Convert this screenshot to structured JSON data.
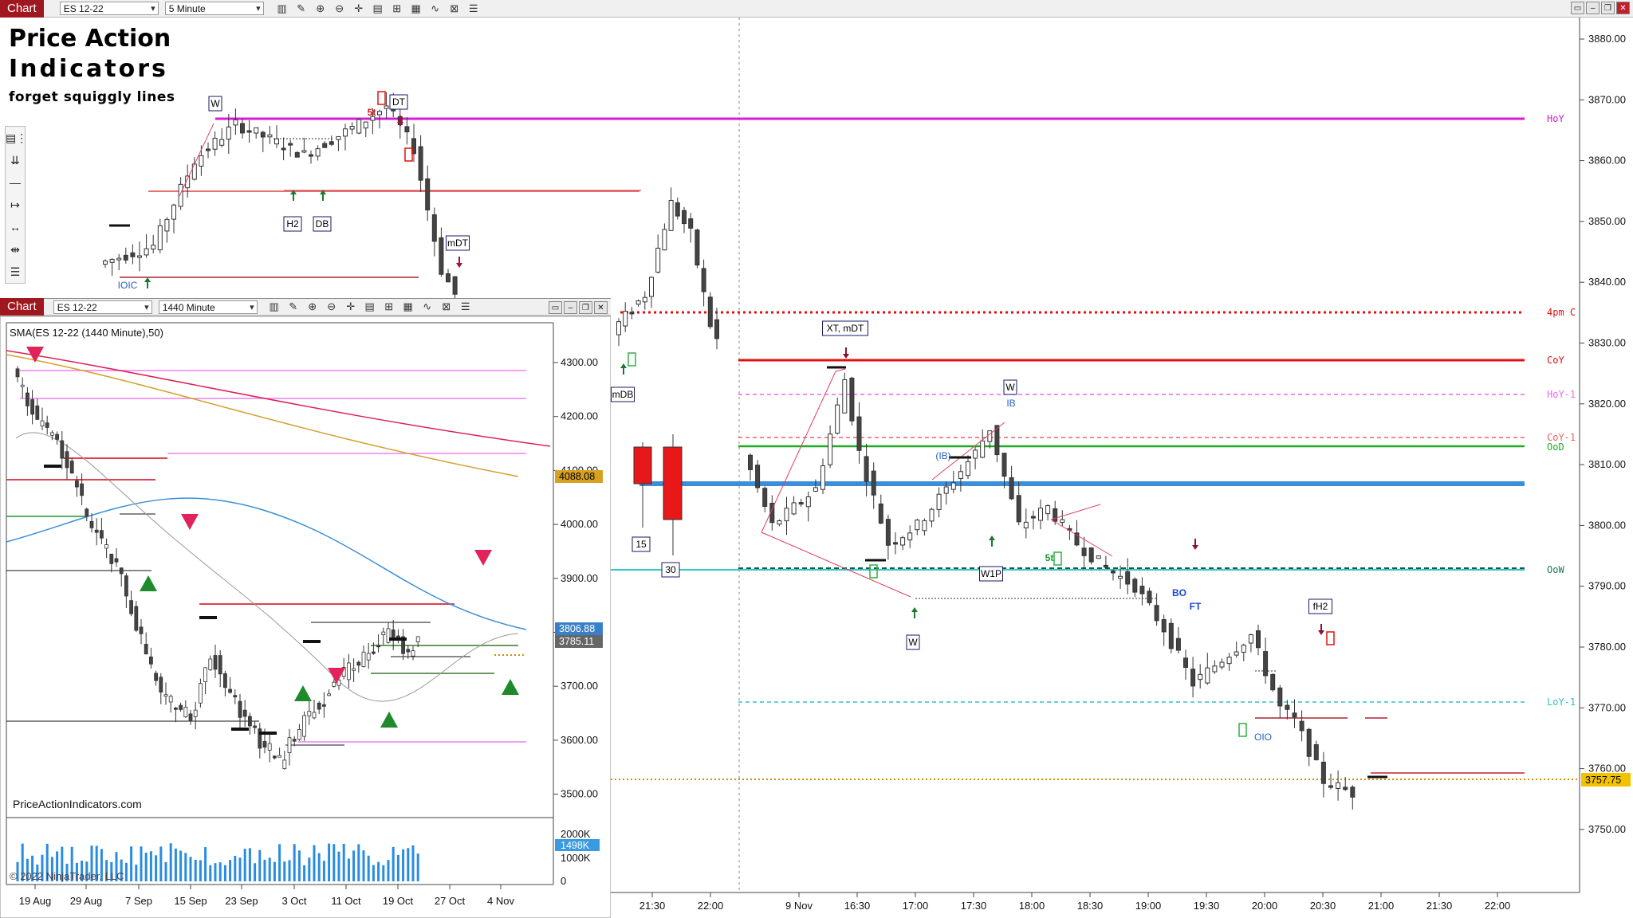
{
  "main_chart": {
    "toolbar": {
      "tag": "Chart",
      "instrument": "ES 12-22",
      "interval": "5 Minute"
    },
    "brand": {
      "line1": "Price Action",
      "line2": "Indicators",
      "tagline": "forget squiggly lines"
    },
    "price_axis": {
      "ticks": [
        "3880.00",
        "3870.00",
        "3860.00",
        "3850.00",
        "3840.00",
        "3830.00",
        "3820.00",
        "3810.00",
        "3800.00",
        "3790.00",
        "3780.00",
        "3770.00",
        "3760.00",
        "3750.00"
      ],
      "last_price": "3757.75"
    },
    "time_axis": [
      "21:30",
      "22:00",
      "9 Nov",
      "16:30",
      "17:00",
      "17:30",
      "18:00",
      "18:30",
      "19:00",
      "19:30",
      "20:00",
      "20:30",
      "21:00",
      "21:30",
      "22:00"
    ],
    "levels": [
      {
        "label": "HoY",
        "color": "#d81bd8"
      },
      {
        "label": "4pm C",
        "color": "#e01010"
      },
      {
        "label": "CoY",
        "color": "#e01010"
      },
      {
        "label": "HoY-1",
        "color": "#ee66ee"
      },
      {
        "label": "CoY-1",
        "color": "#ee6060"
      },
      {
        "label": "OoD",
        "color": "#22aa22"
      },
      {
        "label": "OoW",
        "color": "#1a7a4a"
      },
      {
        "label": "LoY-1",
        "color": "#30c0c8"
      }
    ],
    "annotations": [
      "W",
      "5t",
      "DT",
      "H2",
      "DB",
      "IOIC",
      "mDT",
      "mDB",
      "XT, mDT",
      "W",
      "IB",
      "(IB)",
      "W1P",
      "5t",
      "W",
      "BO",
      "FT",
      "fH2",
      "OIO",
      "15",
      "30"
    ]
  },
  "daily_chart": {
    "toolbar": {
      "tag": "Chart",
      "instrument": "ES 12-22",
      "interval": "1440 Minute"
    },
    "indicator_label": "SMA(ES 12-22 (1440 Minute),50)",
    "watermark": "PriceActionIndicators.com",
    "copyright": "© 2022 NinjaTrader, LLC",
    "price_axis": [
      "4300.00",
      "4200.00",
      "4100.00",
      "4000.00",
      "3900.00",
      "3800.00",
      "3700.00",
      "3600.00",
      "3500.00"
    ],
    "price_badges": [
      "4088.08",
      "3806.88",
      "3785.11"
    ],
    "volume_axis": [
      "2000K",
      "1498K",
      "1000K",
      "0"
    ],
    "date_axis": [
      "19 Aug",
      "29 Aug",
      "7 Sep",
      "15 Sep",
      "23 Sep",
      "3 Oct",
      "11 Oct",
      "19 Oct",
      "27 Oct",
      "4 Nov"
    ]
  },
  "colors": {
    "tag_bg": "#a0181f",
    "up_candle": "#ffffff",
    "down_candle": "#444444",
    "sma_blue": "#3a8fd8",
    "sma_orange": "#d4a030",
    "sma_red": "#dd2255"
  },
  "icons": [
    "bar-chart-icon",
    "pencil-icon",
    "zoom-in-icon",
    "zoom-out-icon",
    "crosshair-icon",
    "properties-icon",
    "data-box-icon",
    "strategy-icon",
    "indicator-icon",
    "list-icon",
    "minimize-icon",
    "maximize-icon",
    "close-icon"
  ]
}
